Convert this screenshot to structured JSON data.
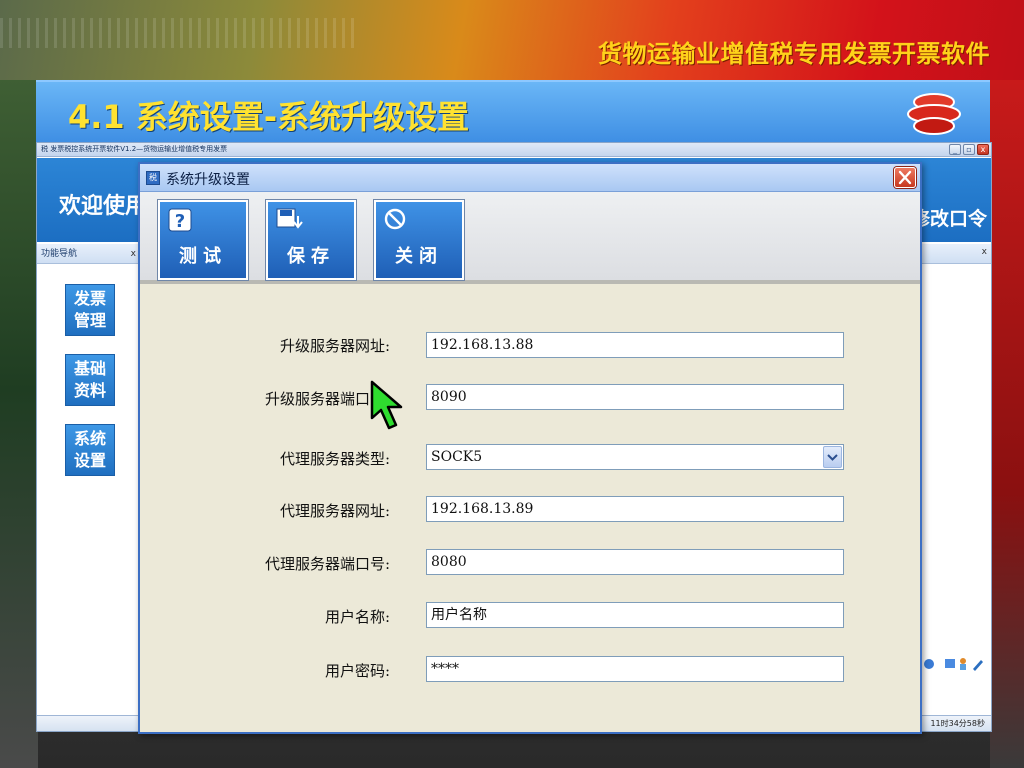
{
  "banner": {
    "product_title": "货物运输业增值税专用发票开票软件"
  },
  "slide": {
    "title": "4.1 系统设置-系统升级设置"
  },
  "app": {
    "window_title": "税 发票税控系统开票软件V1.2—货物运输业增值税专用发票",
    "welcome_text": "欢迎使用",
    "header_right_text": "修改口令",
    "nav_header": "功能导航",
    "nav_close": "x",
    "right_pane_close": "x",
    "nav_items": [
      "发票\n管理",
      "基础\n资料",
      "系统\n设置"
    ],
    "status_time": "11时34分58秒",
    "win_buttons": [
      "_",
      "▫",
      "x"
    ]
  },
  "dialog": {
    "title": "系统升级设置",
    "toolbar": {
      "test_label": "测试",
      "save_label": "保存",
      "close_label": "关闭"
    },
    "fields": [
      {
        "label": "升级服务器网址:",
        "value": "192.168.13.88"
      },
      {
        "label": "升级服务器端口号:",
        "value": "8090"
      },
      {
        "label": "代理服务器类型:",
        "value": "SOCK5"
      },
      {
        "label": "代理服务器网址:",
        "value": "192.168.13.89"
      },
      {
        "label": "代理服务器端口号:",
        "value": "8080"
      },
      {
        "label": "用户名称:",
        "value": "用户名称"
      },
      {
        "label": "用户密码:",
        "value": "****"
      }
    ]
  },
  "icons": {
    "logo": "company-logo-icon",
    "test": "help-icon",
    "save": "save-disk-icon",
    "close": "cancel-circle-icon",
    "cursor": "green-arrow-cursor-icon"
  },
  "colors": {
    "title_yellow": "#ffe230",
    "app_blue": "#1c6ec2",
    "dialog_bg": "#ece9d8",
    "cursor_green": "#2fdc2f"
  }
}
